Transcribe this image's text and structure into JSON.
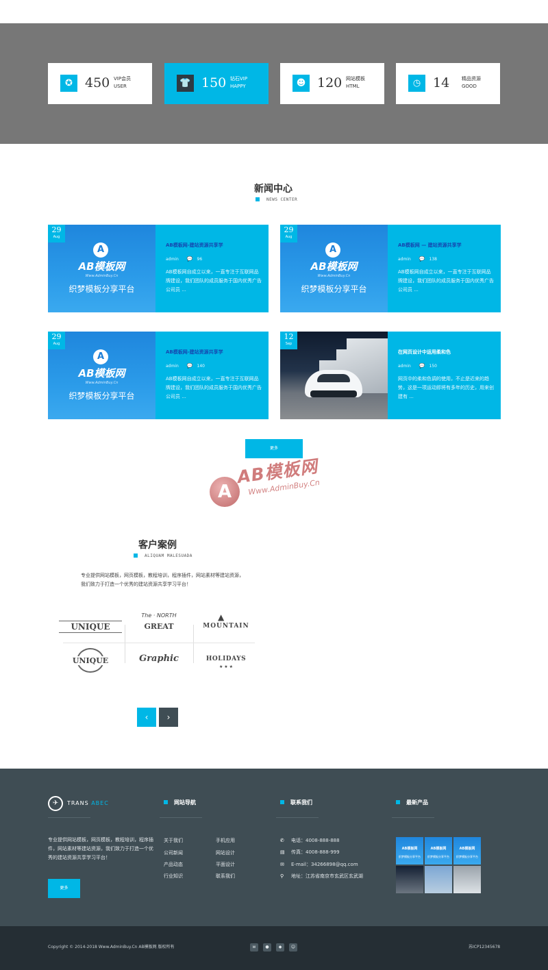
{
  "stats": [
    {
      "number": "450",
      "label1": "VIP会员",
      "label2": "USER",
      "icon": "badge-icon"
    },
    {
      "number": "150",
      "label1": "钻石VIP",
      "label2": "HAPPY",
      "icon": "tshirt-icon"
    },
    {
      "number": "120",
      "label1": "网站模板",
      "label2": "HTML",
      "icon": "group-icon"
    },
    {
      "number": "14",
      "label1": "精品资源",
      "label2": "GOOD",
      "icon": "clock-icon"
    }
  ],
  "news": {
    "title": "新闻中心",
    "subtitle": "NEWS CENTER",
    "thumb_brand": "AB模板网",
    "thumb_url": "Www.AdminBuy.Cn",
    "thumb_slogan": "织梦模板分享平台",
    "items": [
      {
        "day": "29",
        "month": "Aug",
        "title": "AB模板网-建站资源共享学",
        "author": "admin",
        "comments": "96",
        "desc": "AB模板网自成立以来，一直专注于互联网品牌建设，我们团队的成员服务于国内优秀广告公司员 ..."
      },
      {
        "day": "29",
        "month": "Aug",
        "title": "AB模板网 — 建站资源共享学",
        "author": "admin",
        "comments": "138",
        "desc": "AB模板网自成立以来，一直专注于互联网品牌建设，我们团队的成员服务于国内优秀广告公司员 ..."
      },
      {
        "day": "29",
        "month": "Aug",
        "title": "AB模板网-建站资源共享学",
        "author": "admin",
        "comments": "140",
        "desc": "AB模板网自成立以来，一直专注于互联网品牌建设，我们团队的成员服务于国内优秀广告公司员 ..."
      },
      {
        "day": "12",
        "month": "Sep",
        "title": "在网页设计中运用柔和色",
        "author": "admin",
        "comments": "150",
        "desc": "网页中的柔和色调的使用，不止是近来的趋势，这是一项运动即将有多年的历史，用来创建有 ..."
      }
    ],
    "more_label": "更多"
  },
  "watermark": {
    "brand": "AB模板网",
    "url": "Www.AdminBuy.Cn",
    "letter": "A"
  },
  "clients": {
    "title": "客户案例",
    "subtitle": "ALIQUAM MALESUADA",
    "intro": "专业提供网站模板，网页模板，教程培训，程序插件，网站素材等建站资源，我们致力于打造一个优秀的建站资源共享学习平台！",
    "logos": [
      {
        "main": "UNIQUE",
        "sub": ""
      },
      {
        "main": "GREAT",
        "sub": "The · NORTH"
      },
      {
        "main": "MOUNTAIN",
        "sub": ""
      },
      {
        "main": "UNIQUE",
        "sub": ""
      },
      {
        "main": "Graphic",
        "sub": ""
      },
      {
        "main": "HOLIDAYS",
        "sub": ""
      }
    ],
    "prev": "‹",
    "next": "›"
  },
  "footer": {
    "logo_text": "TRANS",
    "logo_accent": "ABEC",
    "about": "专业提供网站模板，网页模板，教程培训，程序插件，网站素材等建站资源，我们致力于打造一个优秀的建站资源共享学习平台！",
    "about_button": "更多",
    "nav_title": "网站导航",
    "nav_col1": [
      "关于我们",
      "公司新闻",
      "产品动态",
      "行业知识"
    ],
    "nav_col2": [
      "手机应用",
      "网站设计",
      "平面设计",
      "联系我们"
    ],
    "contact_title": "联系我们",
    "contact": [
      {
        "icon": "phone-icon",
        "text": "电话：4008-888-888"
      },
      {
        "icon": "fax-icon",
        "text": "传真：4008-888-999"
      },
      {
        "icon": "mail-icon",
        "text": "E-mail：34266898@qq.com"
      },
      {
        "icon": "location-icon",
        "text": "地址：江苏省南京市玄武区玄武湖"
      }
    ],
    "products_title": "最新产品",
    "product_brand": "AB模板网",
    "product_slogan": "织梦模板分享平台"
  },
  "bottom": {
    "copyright": "Copyright © 2014-2018 Www.AdminBuy.Cn AB模板网 版权所有",
    "icp": "苏ICP12345678",
    "social": [
      "weibo-icon",
      "wechat-icon",
      "qq-icon",
      "user-icon"
    ]
  },
  "colors": {
    "accent": "#00b7e6",
    "dark": "#2e3a43",
    "footer": "#3f4d54",
    "bottom": "#252e34",
    "band": "#777777"
  }
}
